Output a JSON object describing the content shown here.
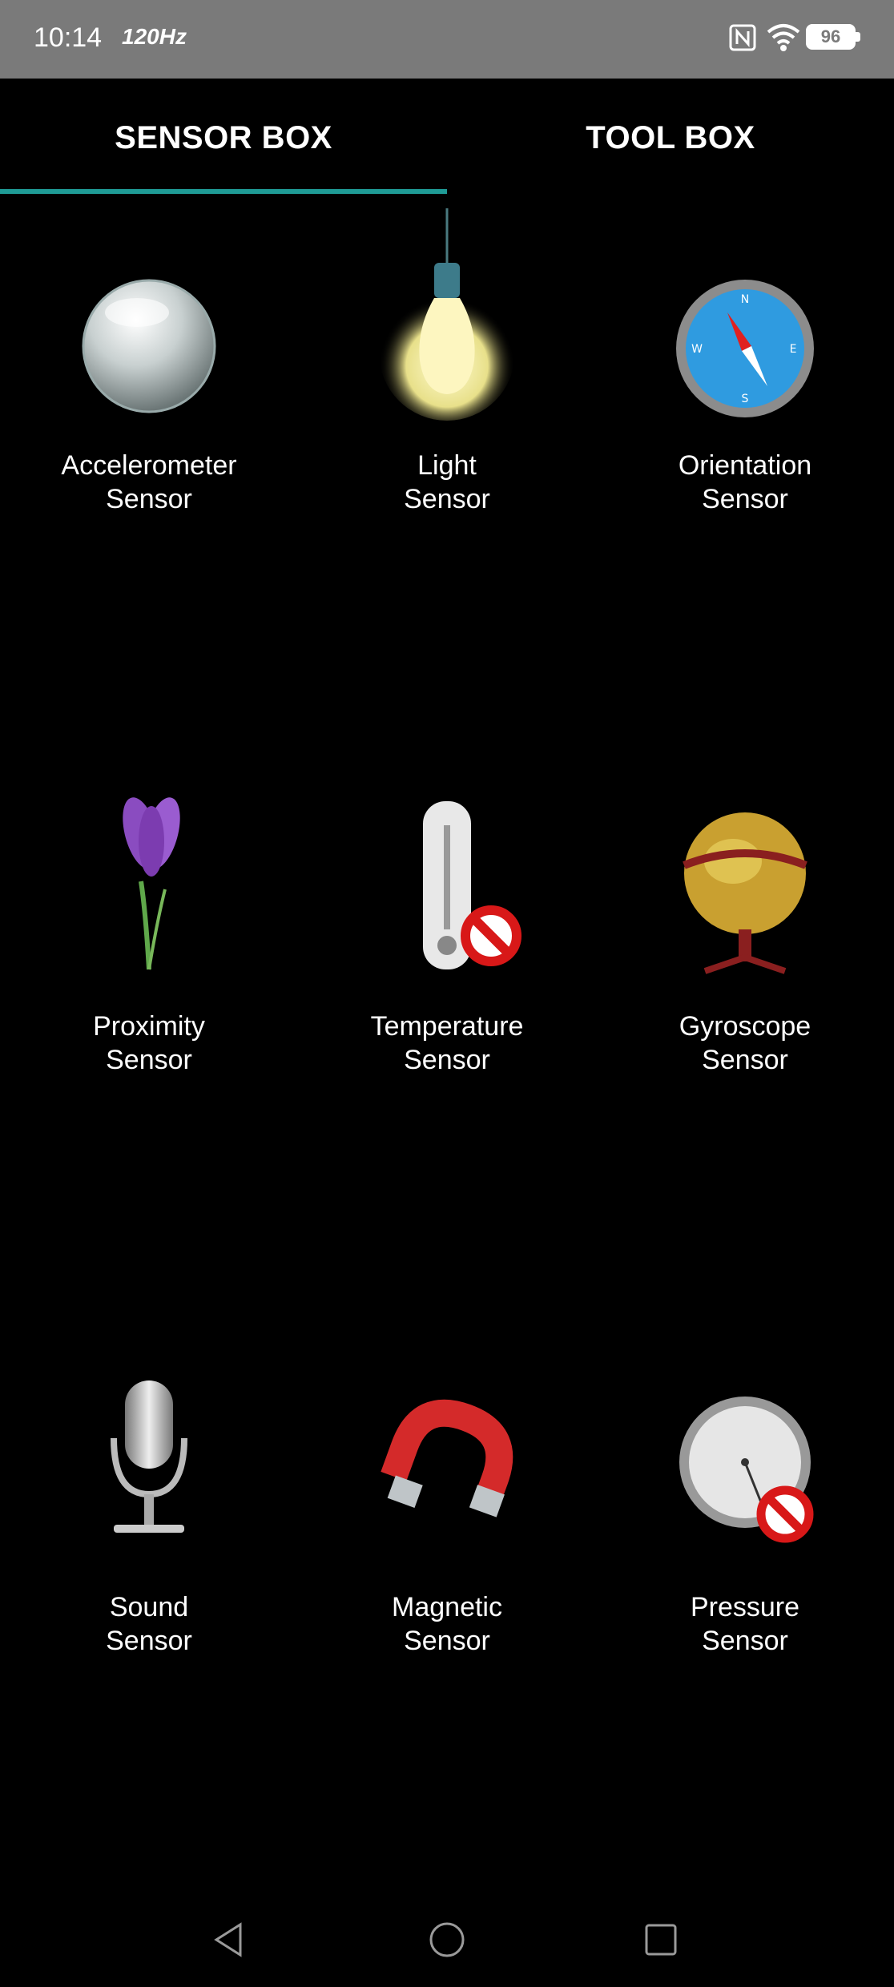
{
  "status_bar": {
    "time": "10:14",
    "refresh_rate": "120Hz",
    "battery": "96"
  },
  "tabs": [
    {
      "label": "SENSOR BOX",
      "selected": true
    },
    {
      "label": "TOOL BOX",
      "selected": false
    }
  ],
  "accent_color": "#1f9b96",
  "sensors": [
    {
      "icon": "glass-sphere-icon",
      "line1": "Accelerometer",
      "line2": "Sensor"
    },
    {
      "icon": "light-bulb-icon",
      "line1": "Light",
      "line2": "Sensor"
    },
    {
      "icon": "compass-icon",
      "line1": "Orientation",
      "line2": "Sensor"
    },
    {
      "icon": "crocus-flower-icon",
      "line1": "Proximity",
      "line2": "Sensor"
    },
    {
      "icon": "thermometer-unavailable-icon",
      "line1": "Temperature",
      "line2": "Sensor"
    },
    {
      "icon": "globe-gyroscope-icon",
      "line1": "Gyroscope",
      "line2": "Sensor"
    },
    {
      "icon": "microphone-icon",
      "line1": "Sound",
      "line2": "Sensor"
    },
    {
      "icon": "horseshoe-magnet-icon",
      "line1": "Magnetic",
      "line2": "Sensor"
    },
    {
      "icon": "barometer-unavailable-icon",
      "line1": "Pressure",
      "line2": "Sensor"
    }
  ],
  "nav": {
    "back": "back-icon",
    "home": "home-icon",
    "recents": "recents-icon"
  }
}
